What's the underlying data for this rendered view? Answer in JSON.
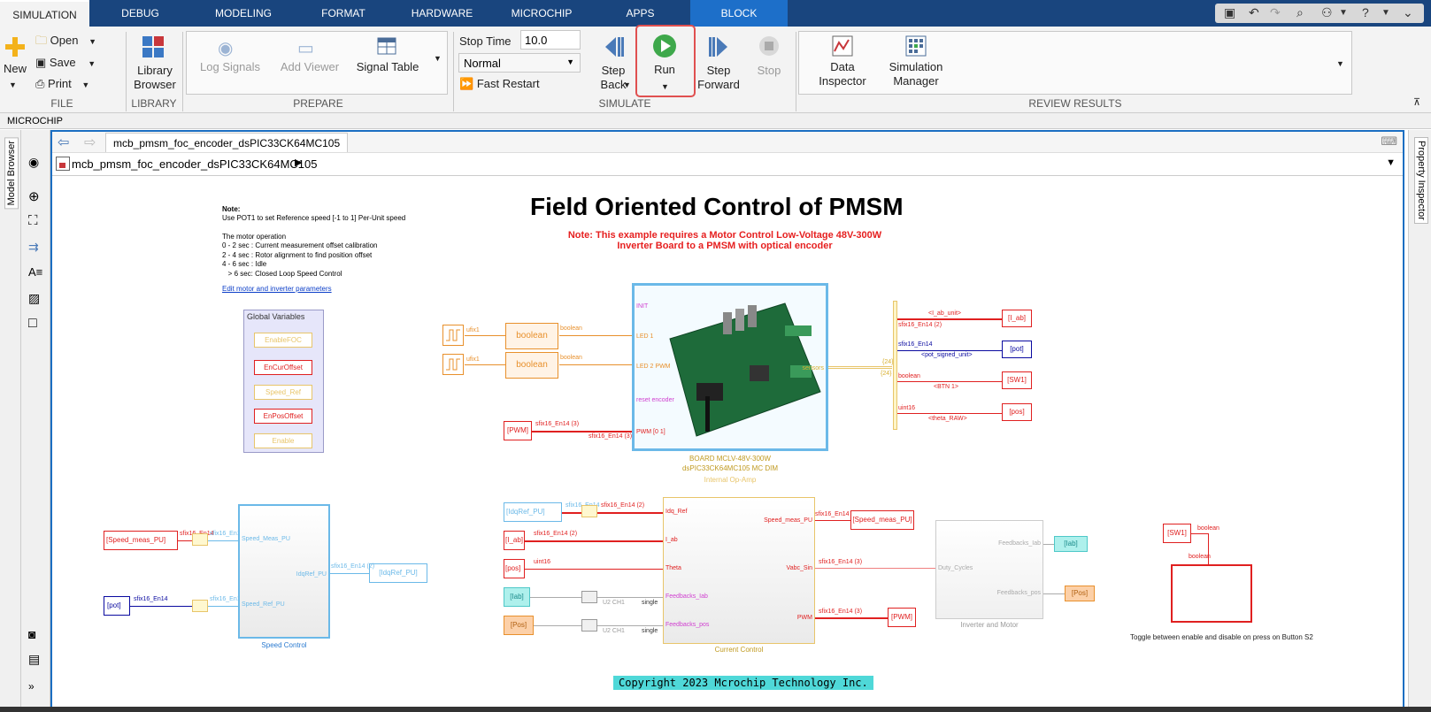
{
  "tabs": [
    "SIMULATION",
    "DEBUG",
    "MODELING",
    "FORMAT",
    "HARDWARE",
    "MICROCHIP",
    "APPS",
    "BLOCK"
  ],
  "ribbon": {
    "file": {
      "new": "New",
      "open": "Open",
      "save": "Save",
      "print": "Print",
      "label": "FILE"
    },
    "library": {
      "browser": "Library Browser",
      "label": "LIBRARY"
    },
    "prepare": {
      "log_signals": "Log Signals",
      "add_viewer": "Add Viewer",
      "signal_table": "Signal Table",
      "label": "PREPARE"
    },
    "simulate": {
      "stop_time_label": "Stop Time",
      "stop_time_value": "10.0",
      "mode": "Normal",
      "fast_restart": "Fast Restart",
      "step_back": "Step Back",
      "run": "Run",
      "step_forward": "Step Forward",
      "stop": "Stop",
      "label": "SIMULATE"
    },
    "review": {
      "data_inspector": "Data Inspector",
      "sim_manager": "Simulation Manager",
      "label": "REVIEW RESULTS"
    }
  },
  "subbar": "MICROCHIP",
  "side": {
    "model_browser": "Model Browser",
    "property_inspector": "Property Inspector"
  },
  "nav": {
    "tab": "mcb_pmsm_foc_encoder_dsPIC33CK64MC105",
    "breadcrumb": "mcb_pmsm_foc_encoder_dsPIC33CK64MC105"
  },
  "model": {
    "title": "Field Oriented Control of PMSM",
    "red_note_1": "Note: This example requires a Motor Control Low-Voltage 48V-300W",
    "red_note_2": "Inverter Board to a PMSM with optical encoder",
    "note_heading": "Note:",
    "note_lines": [
      "Use POT1 to set Reference speed [-1 to 1] Per-Unit speed",
      "",
      "The motor operation",
      "0 - 2 sec : Current measurement offset calibration",
      "2 - 4 sec : Rotor alignment to find position offset",
      "4 - 6 sec : Idle",
      "   > 6 sec: Closed Loop Speed Control"
    ],
    "edit_link": "Edit motor and inverter parameters",
    "global_vars_title": "Global Variables",
    "global_vars": [
      "EnableFOC",
      "EnCurOffset",
      "Speed_Ref",
      "EnPosOffset",
      "Enable"
    ],
    "board_caption_1": "BOARD MCLV-48V-300W",
    "board_caption_2": "dsPIC33CK64MC105 MC DIM",
    "board_caption_3": "Internal Op-Amp",
    "board_ports": [
      "INIT",
      "LED 1",
      "LED 2 PWM",
      "reset encoder",
      "PWM [0 1]"
    ],
    "board_out": "sensors",
    "bool_block": "boolean",
    "outputs": [
      {
        "tag": "[I_ab]",
        "top": "<I_ab_unit>",
        "side": "sfix16_En14 (2)"
      },
      {
        "tag": "[pot]",
        "top": "sfix16_En14",
        "side": "<pot_signed_unit>"
      },
      {
        "tag": "[SW1]",
        "top": "boolean",
        "side": "<BTN 1>"
      },
      {
        "tag": "[pos]",
        "top": "uint16",
        "side": "<theta_RAW>"
      }
    ],
    "speed_inputs": [
      "[Speed_meas_PU]",
      "[pot]"
    ],
    "speed_ctrl_ports": [
      "Speed_Meas_PU",
      "Speed_Ref_PU",
      "IdqRef_PU"
    ],
    "speed_ctrl_label": "Speed Control",
    "idq_tag": "[IdqRef_PU]",
    "cc_inputs": [
      "[IdqRef_PU]",
      "[I_ab]",
      "[pos]",
      "[Iab]",
      "[Pos]"
    ],
    "cc_in_ports": [
      "Idq_Ref",
      "I_ab",
      "Theta",
      "Feedbacks_Iab",
      "Feedbacks_pos"
    ],
    "cc_out_ports": [
      "Speed_meas_PU",
      "Vabc_Sin",
      "PWM"
    ],
    "cc_label": "Current Control",
    "cc_out_tags": [
      "[Speed_meas_PU]",
      "[PWM]"
    ],
    "inv_ports": [
      "Duty_Cycles",
      "Feedbacks_Iab",
      "Feedbacks_pos"
    ],
    "inv_label": "Inverter and Motor",
    "inv_out_tags": [
      "[Iab]",
      "[Pos]"
    ],
    "toggle_in": "[SW1]",
    "toggle_label": "Toggle between enable and disable on press on Button S2",
    "pwm_tag": "[PWM]",
    "copyright": "Copyright 2023 Mcrochip Technology Inc.",
    "sig": {
      "sfix16_En14": "sfix16_En14",
      "sfix16_En14_2": "sfix16_En14 (2)",
      "sfix16_En14_3": "sfix16_En14 (3)",
      "uint16": "uint16",
      "boolean": "boolean",
      "ufix1": "ufix1",
      "single": "single",
      "u2ch1": "U2 CH1",
      "n24": "{24}"
    }
  }
}
